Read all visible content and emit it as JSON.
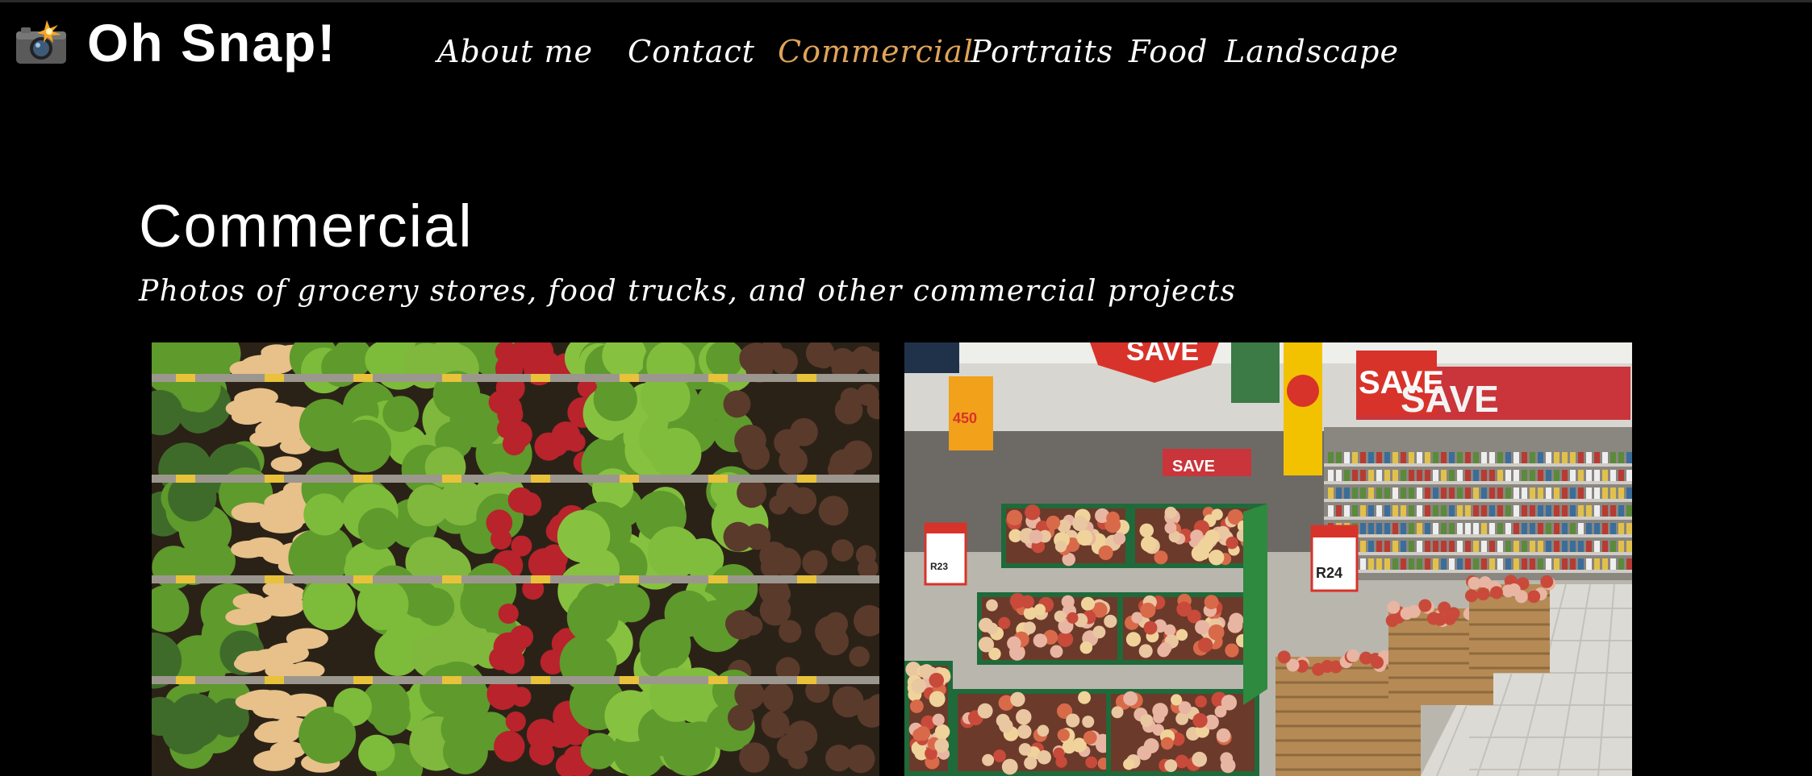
{
  "site": {
    "logo_icon": "camera-with-flash-icon",
    "logo_text": "Oh Snap!"
  },
  "nav": {
    "items": [
      {
        "label": "About me"
      },
      {
        "label": "Contact"
      },
      {
        "label": "Commercial",
        "active": true
      },
      {
        "label": "Portraits"
      },
      {
        "label": "Food"
      },
      {
        "label": "Landscape"
      }
    ],
    "active_color": "#e0a35a"
  },
  "main": {
    "title": "Commercial",
    "subtitle": "Photos of grocery stores, food trucks, and other commercial projects"
  },
  "photos": [
    {
      "subject": "produce-shelves-photo"
    },
    {
      "subject": "supermarket-aisle-photo",
      "signs": [
        "SAVE",
        "SAVE",
        "SAVE",
        "SAVE",
        "R24",
        "R23",
        "450"
      ]
    }
  ]
}
